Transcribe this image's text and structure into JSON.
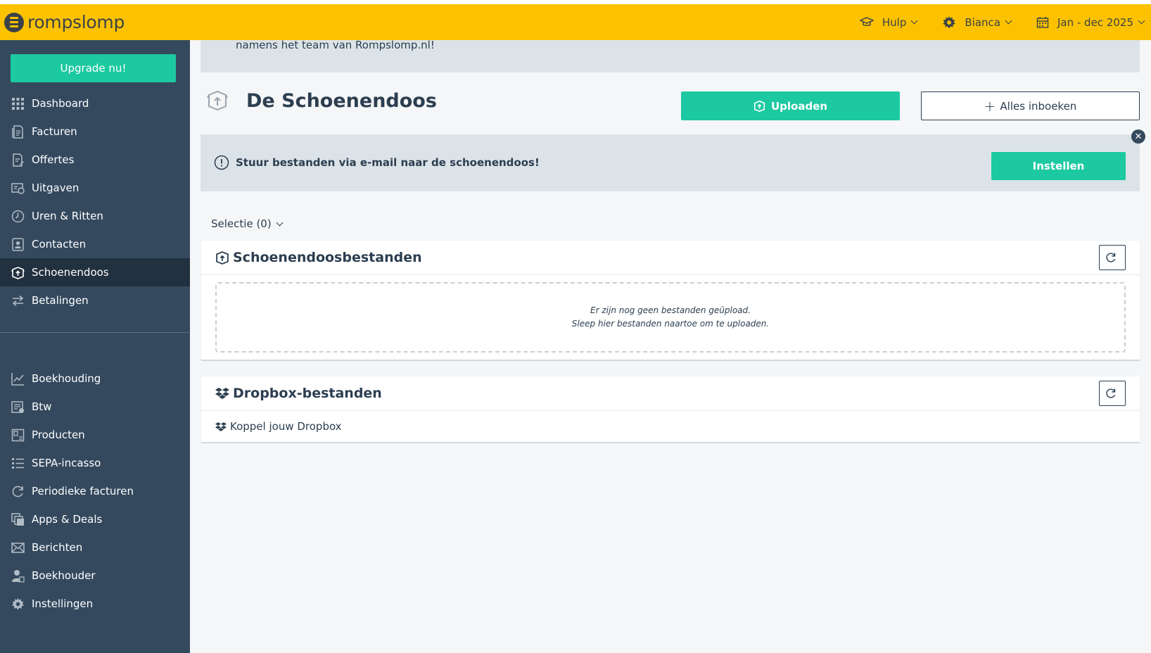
{
  "app": {
    "logo_text": "rompslomp"
  },
  "topnav": {
    "help_label": "Hulp",
    "user_label": "Bianca",
    "period_label": "Jan - dec 2025"
  },
  "sidebar": {
    "upgrade_label": "Upgrade nu!",
    "items_primary": [
      {
        "label": "Dashboard",
        "icon": "grid-icon"
      },
      {
        "label": "Facturen",
        "icon": "invoice-icon"
      },
      {
        "label": "Offertes",
        "icon": "quote-icon"
      },
      {
        "label": "Uitgaven",
        "icon": "expenses-icon"
      },
      {
        "label": "Uren & Ritten",
        "icon": "clock-icon"
      },
      {
        "label": "Contacten",
        "icon": "contact-icon"
      },
      {
        "label": "Schoenendoos",
        "icon": "shoebox-icon",
        "active": true
      },
      {
        "label": "Betalingen",
        "icon": "transfer-icon"
      }
    ],
    "items_secondary": [
      {
        "label": "Boekhouding",
        "icon": "chart-icon"
      },
      {
        "label": "Btw",
        "icon": "tax-icon"
      },
      {
        "label": "Producten",
        "icon": "product-icon"
      },
      {
        "label": "SEPA-incasso",
        "icon": "list-icon"
      },
      {
        "label": "Periodieke facturen",
        "icon": "refresh-icon"
      },
      {
        "label": "Apps & Deals",
        "icon": "apps-icon"
      },
      {
        "label": "Berichten",
        "icon": "mail-icon"
      },
      {
        "label": "Boekhouder",
        "icon": "accountant-icon"
      },
      {
        "label": "Instellingen",
        "icon": "gear-icon"
      }
    ]
  },
  "main": {
    "banner_text": "namens het team van Rompslomp.nl!",
    "page_title": "De Schoenendoos",
    "upload_label": "Uploaden",
    "book_all_label": "Alles inboeken",
    "email_notice": "Stuur bestanden via e-mail naar de schoenendoos!",
    "instellen_label": "Instellen",
    "close_symbol": "✕",
    "selectie_label": "Selectie (0)",
    "shoebox_files": {
      "title": "Schoenendoosbestanden",
      "empty_line1": "Er zijn nog geen bestanden geüpload.",
      "empty_line2": "Sleep hier bestanden naartoe om te uploaden."
    },
    "dropbox_files": {
      "title": "Dropbox-bestanden",
      "connect_label": "Koppel jouw Dropbox"
    }
  },
  "colors": {
    "topbar": "#fcc200",
    "sidebar": "#34495e",
    "sidebar_active": "#22313f",
    "accent": "#1cc9a1",
    "info_box": "#dce3e8"
  }
}
